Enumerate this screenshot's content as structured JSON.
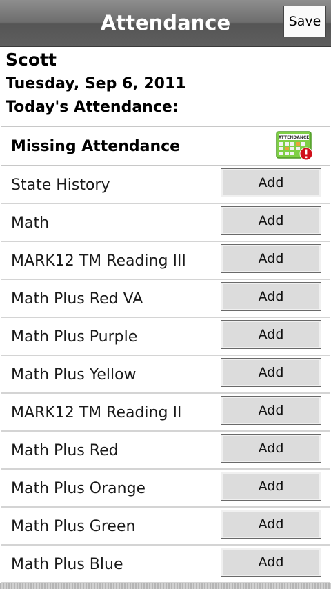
{
  "titlebar": {
    "title": "Attendance",
    "save_label": "Save"
  },
  "student": {
    "name": "Scott",
    "date": "Tuesday, Sep 6, 2011",
    "attendance_label": "Today's Attendance:"
  },
  "section": {
    "title": "Missing Attendance",
    "icon": "attendance-alert-icon",
    "icon_text": "ATTENDANCE"
  },
  "courses": [
    {
      "name": "State History",
      "action": "Add"
    },
    {
      "name": "Math",
      "action": "Add"
    },
    {
      "name": "MARK12 TM Reading III",
      "action": "Add"
    },
    {
      "name": "Math Plus Red VA",
      "action": "Add"
    },
    {
      "name": "Math Plus Purple",
      "action": "Add"
    },
    {
      "name": "Math Plus Yellow",
      "action": "Add"
    },
    {
      "name": "MARK12 TM Reading II",
      "action": "Add"
    },
    {
      "name": "Math Plus Red",
      "action": "Add"
    },
    {
      "name": "Math Plus Orange",
      "action": "Add"
    },
    {
      "name": "Math Plus Green",
      "action": "Add"
    },
    {
      "name": "Math Plus Blue",
      "action": "Add"
    }
  ],
  "colors": {
    "titlebar": "#6d6d6d",
    "icon_green": "#6cbf3a",
    "icon_alert": "#d0101a",
    "button_face": "#dcdcdc"
  }
}
